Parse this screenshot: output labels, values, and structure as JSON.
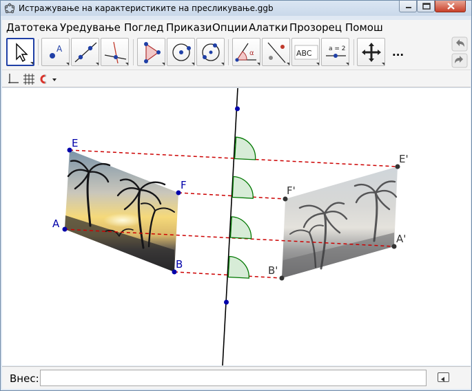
{
  "window": {
    "title": "Истражување на карактеристиките на пресликување.ggb"
  },
  "menu": {
    "items": [
      "Датотека",
      "Уредување",
      "Поглед",
      "Прикази",
      "Опции",
      "Алатки",
      "Прозорец",
      "Помош"
    ]
  },
  "toolbar": {
    "tools": [
      {
        "icon": "move-pointer-icon",
        "selected": true
      },
      {
        "icon": "new-point-icon",
        "label": "A"
      },
      {
        "icon": "line-through-two-points-icon"
      },
      {
        "icon": "perpendicular-line-icon"
      },
      {
        "icon": "polygon-icon"
      },
      {
        "icon": "circle-center-point-icon"
      },
      {
        "icon": "circle-three-points-icon"
      },
      {
        "icon": "angle-icon",
        "label": "α"
      },
      {
        "icon": "reflect-about-line-icon"
      },
      {
        "icon": "text-icon",
        "label": "ABC"
      },
      {
        "icon": "slider-icon",
        "label": "a = 2"
      },
      {
        "icon": "move-graphics-view-icon"
      }
    ],
    "more_label": "...",
    "undo_icon": "undo-icon",
    "redo_icon": "redo-icon"
  },
  "style_bar": {
    "axes_icon": "axes-icon",
    "grid_icon": "grid-icon",
    "magnet_icon": "point-capturing-icon"
  },
  "graphics": {
    "points": {
      "A": "A",
      "B": "B",
      "E": "E",
      "F": "F",
      "A_prime": "A'",
      "B_prime": "B'",
      "E_prime": "E'",
      "F_prime": "F'"
    },
    "colors": {
      "point_blue": "#0000aa",
      "point_dark": "#333333",
      "dash_red": "#cc0000",
      "angle_green": "#007700",
      "angle_fill": "#d7ecd7",
      "mirror_line": "#000000"
    }
  },
  "input_bar": {
    "label": "Внес:",
    "value": "",
    "help_icon": "input-help-icon"
  }
}
